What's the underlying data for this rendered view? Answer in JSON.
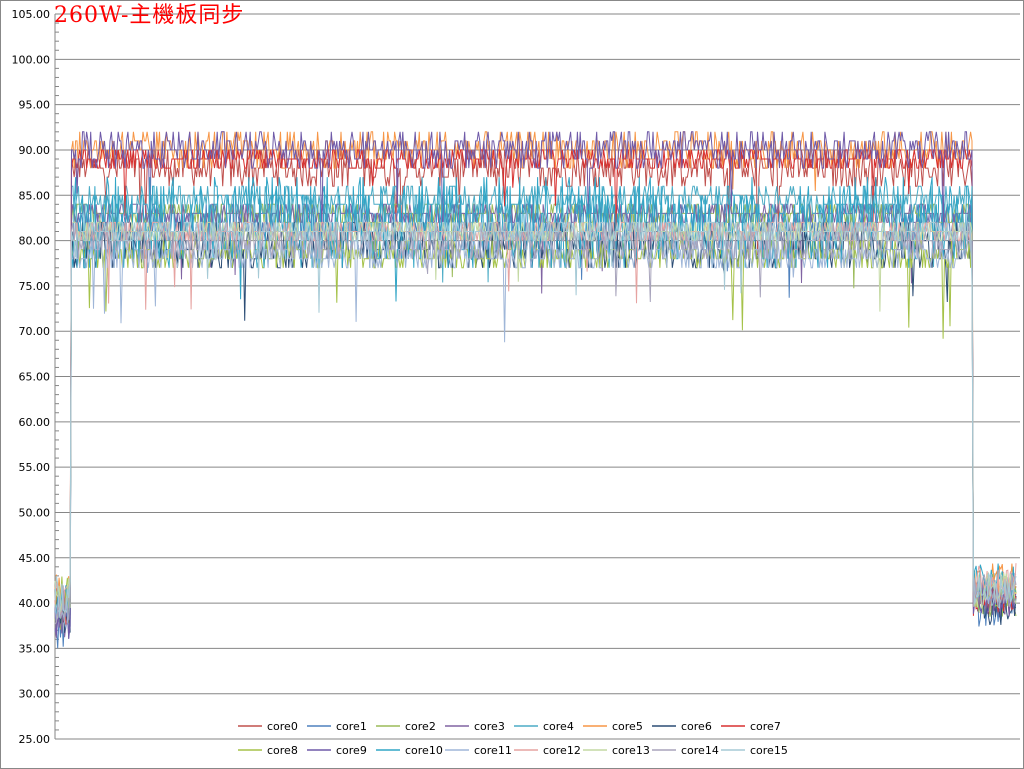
{
  "chart_data": {
    "type": "line",
    "title": "260W-主機板同步",
    "xlabel": "",
    "ylabel": "",
    "ylim": [
      25,
      105
    ],
    "yticks": [
      "25.00",
      "30.00",
      "35.00",
      "40.00",
      "45.00",
      "50.00",
      "55.00",
      "60.00",
      "65.00",
      "70.00",
      "75.00",
      "80.00",
      "85.00",
      "90.00",
      "95.00",
      "100.00",
      "105.00"
    ],
    "grid": true,
    "legend_position": "bottom",
    "samples": 700,
    "load_start_fraction": 0.016,
    "load_end_fraction": 0.955,
    "series": [
      {
        "name": "core0",
        "color": "#c0504d",
        "idle_start": 39,
        "load_min": 86,
        "load_max": 90,
        "idle_end": 40
      },
      {
        "name": "core1",
        "color": "#4f81bd",
        "idle_start": 37,
        "load_min": 80,
        "load_max": 84,
        "idle_end": 39
      },
      {
        "name": "core2",
        "color": "#9bbb59",
        "idle_start": 39,
        "load_min": 82,
        "load_max": 84,
        "idle_end": 40
      },
      {
        "name": "core3",
        "color": "#8064a2",
        "idle_start": 38,
        "load_min": 82,
        "load_max": 84,
        "idle_end": 40
      },
      {
        "name": "core4",
        "color": "#4bacc6",
        "idle_start": 40,
        "load_min": 83,
        "load_max": 86,
        "idle_end": 41
      },
      {
        "name": "core5",
        "color": "#f79646",
        "idle_start": 41,
        "load_min": 88,
        "load_max": 92,
        "idle_end": 42
      },
      {
        "name": "core6",
        "color": "#2c4d75",
        "idle_start": 38,
        "load_min": 77,
        "load_max": 82,
        "idle_end": 39
      },
      {
        "name": "core7",
        "color": "#d83030",
        "idle_start": 39,
        "load_min": 88,
        "load_max": 90,
        "idle_end": 40
      },
      {
        "name": "core8",
        "color": "#a5c249",
        "idle_start": 40,
        "load_min": 77,
        "load_max": 80,
        "idle_end": 41
      },
      {
        "name": "core9",
        "color": "#6f5aa8",
        "idle_start": 38,
        "load_min": 88,
        "load_max": 92,
        "idle_end": 40
      },
      {
        "name": "core10",
        "color": "#31a5c6",
        "idle_start": 40,
        "load_min": 77,
        "load_max": 87,
        "idle_end": 42
      },
      {
        "name": "core11",
        "color": "#9fb6d8",
        "idle_start": 39,
        "load_min": 77,
        "load_max": 80,
        "idle_end": 41
      },
      {
        "name": "core12",
        "color": "#e6a3a1",
        "idle_start": 40,
        "load_min": 80,
        "load_max": 82,
        "idle_end": 42
      },
      {
        "name": "core13",
        "color": "#c4d9a3",
        "idle_start": 40,
        "load_min": 80,
        "load_max": 82,
        "idle_end": 41
      },
      {
        "name": "core14",
        "color": "#a8a4bc",
        "idle_start": 39,
        "load_min": 78,
        "load_max": 82,
        "idle_end": 41
      },
      {
        "name": "core15",
        "color": "#a6cad6",
        "idle_start": 40,
        "load_min": 80,
        "load_max": 82,
        "idle_end": 41
      }
    ]
  }
}
